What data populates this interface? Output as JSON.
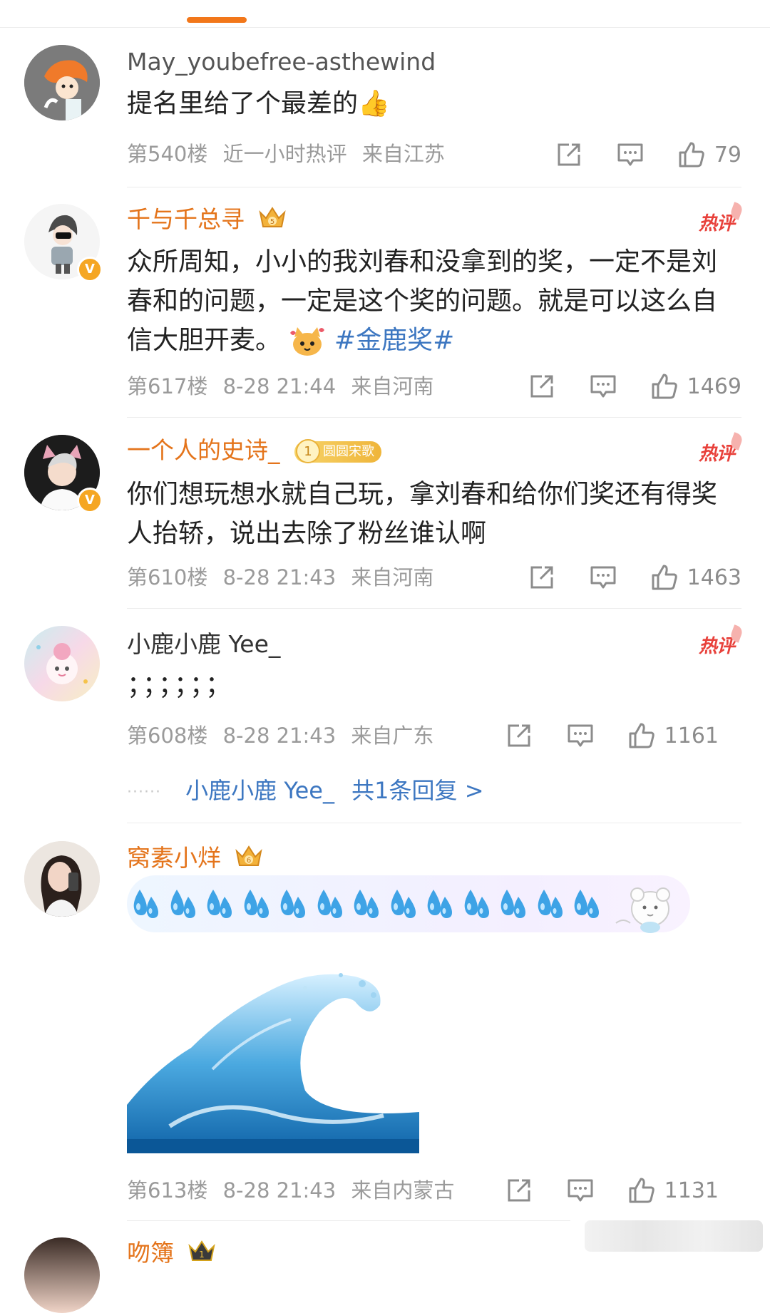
{
  "comments": [
    {
      "username": "May_youbefree-asthewind",
      "text": "提名里给了个最差的",
      "emoji": "👍",
      "floor": "第540楼",
      "time": "近一小时热评",
      "location": "来自江苏",
      "likes": "79"
    },
    {
      "username": "千与千总寻",
      "crown_level": "5",
      "hot_label": "热评",
      "text": "众所周知，小小的我刘春和没拿到的奖，一定不是刘春和的问题，一定是这个奖的问题。就是可以这么自信大胆开麦。",
      "hashtag": "#金鹿奖#",
      "floor": "第617楼",
      "time": "8-28 21:44",
      "location": "来自河南",
      "likes": "1469"
    },
    {
      "username": "一个人的史诗_",
      "badge_level": "1",
      "badge_text": "圆圆宋歌",
      "hot_label": "热评",
      "text": "你们想玩想水就自己玩，拿刘春和给你们奖还有得奖人抬轿，说出去除了粉丝谁认啊",
      "floor": "第610楼",
      "time": "8-28 21:43",
      "location": "来自河南",
      "likes": "1463"
    },
    {
      "username": "小鹿小鹿 Yee_",
      "hot_label": "热评",
      "text": "；；；；；；",
      "floor": "第608楼",
      "time": "8-28 21:43",
      "location": "来自广东",
      "likes": "1161",
      "reply_dots": "······",
      "reply_user": "小鹿小鹿 Yee_",
      "reply_count": "共1条回复 >"
    },
    {
      "username": "窝素小烊",
      "crown_level": "6",
      "floor": "第613楼",
      "time": "8-28 21:43",
      "location": "来自内蒙古",
      "likes": "1131"
    },
    {
      "username": "吻簿",
      "crown_level": "1"
    }
  ],
  "icons": {
    "share": "share-icon",
    "comment": "comment-icon",
    "like": "like-icon",
    "drop": "sweat-drops-emoji",
    "wave": "water-wave-image"
  },
  "colors": {
    "accent_orange": "#f2771a",
    "vip_name": "#e4741b",
    "link_blue": "#3d77c1",
    "hot_red": "#e8413b",
    "meta_gray": "#9a9a9a"
  }
}
